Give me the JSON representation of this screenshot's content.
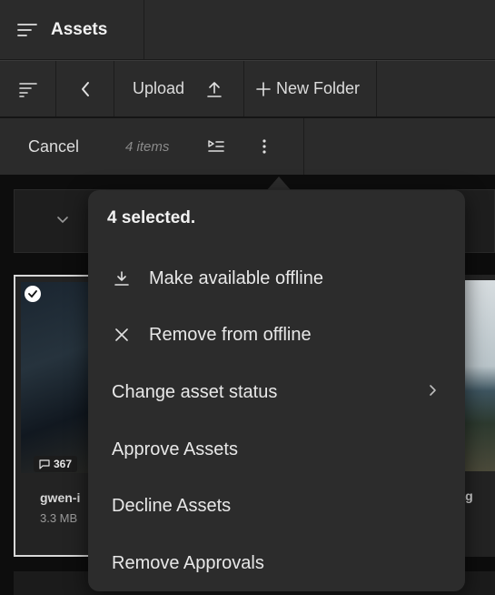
{
  "header": {
    "title": "Assets",
    "menu_icon": "hamburger-icon"
  },
  "toolbar": {
    "upload_label": "Upload",
    "new_folder_label": "New Folder"
  },
  "selection_bar": {
    "cancel_label": "Cancel",
    "item_count": "4 items"
  },
  "cards": [
    {
      "badge_count": "367",
      "name": "gwen-i",
      "size": "3.3 MB"
    },
    {
      "name": "imag"
    }
  ],
  "popover": {
    "title": "4 selected.",
    "items": [
      {
        "label": "Make available offline",
        "icon": "download-icon"
      },
      {
        "label": "Remove from offline",
        "icon": "close-icon"
      },
      {
        "label": "Change asset status",
        "icon": "chevron-right-icon"
      },
      {
        "label": "Approve Assets"
      },
      {
        "label": "Decline Assets"
      },
      {
        "label": "Remove Approvals"
      }
    ]
  },
  "colors": {
    "bar_bg": "#2b2b2b",
    "popover_bg": "#2c2c2c",
    "content_bg": "#0d0d0d"
  }
}
